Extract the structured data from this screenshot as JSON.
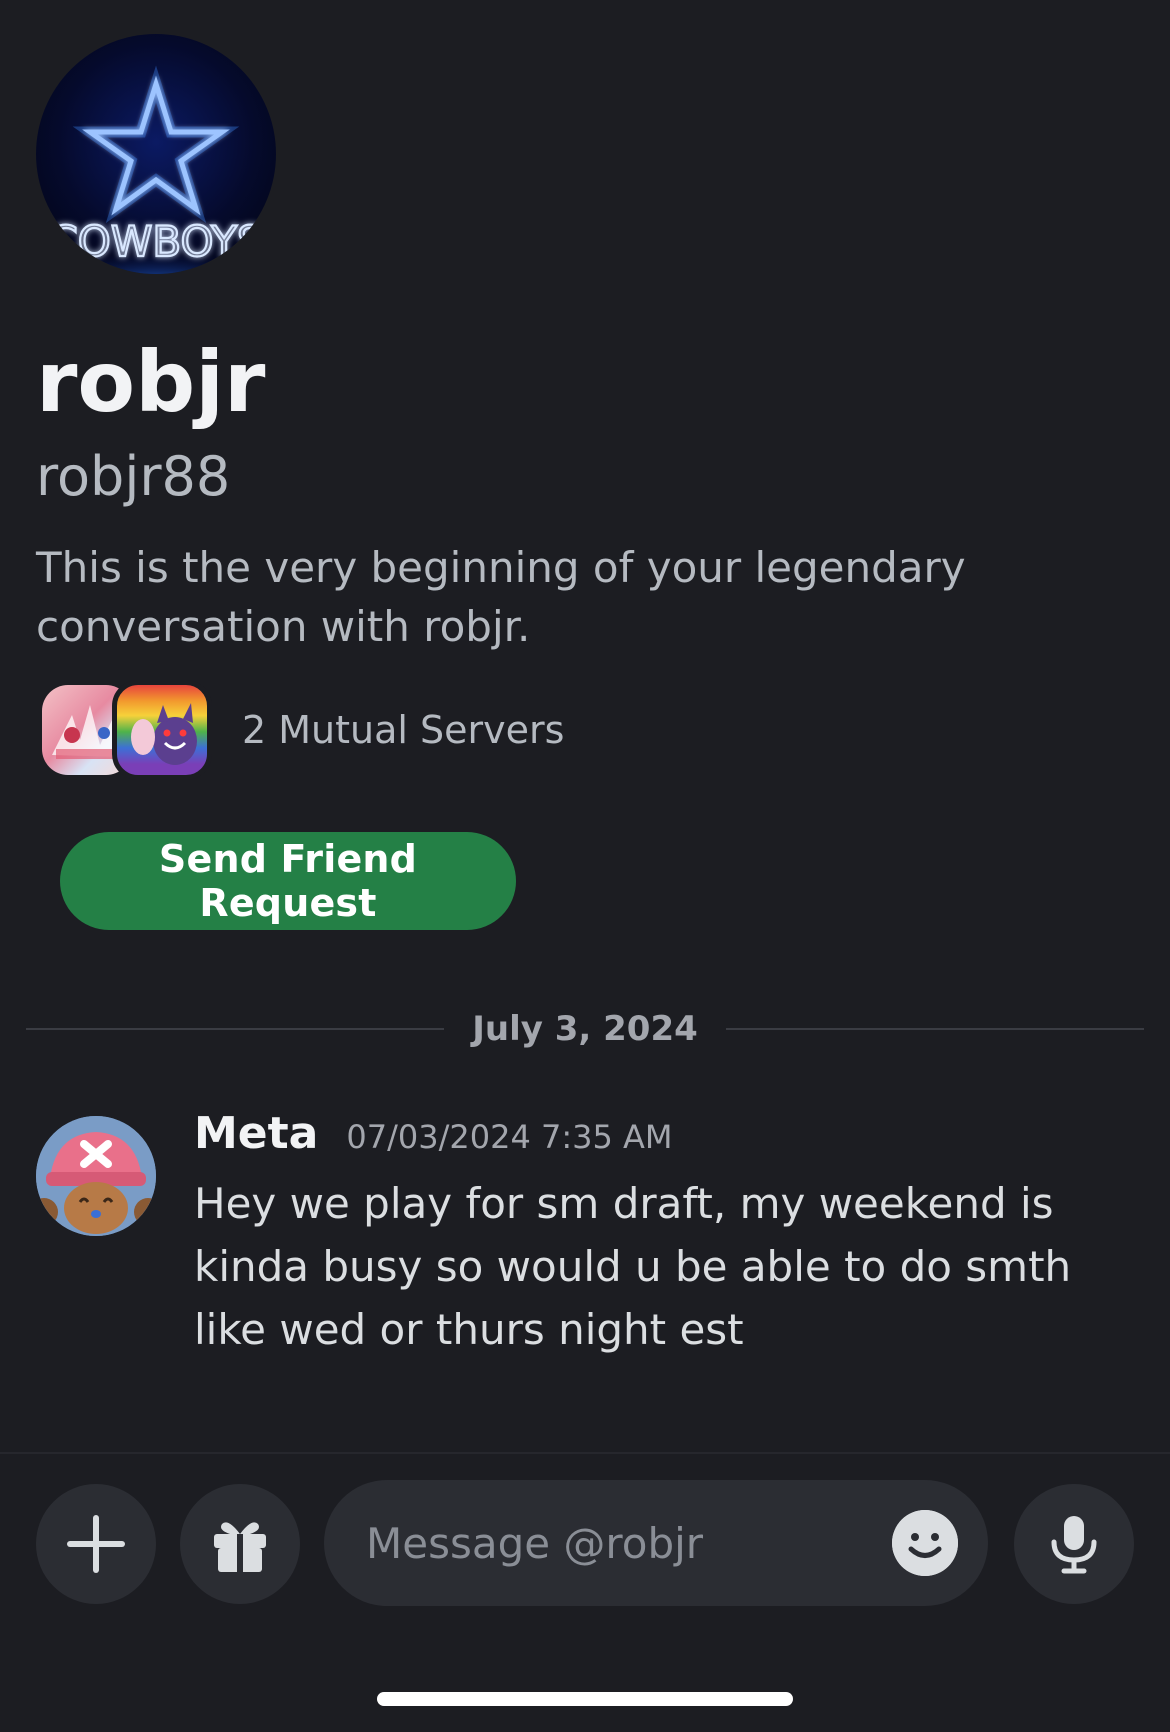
{
  "profile": {
    "avatar_icon": "cowboys-neon-star-logo",
    "avatar_text": "COWBOYS",
    "display_name": "robjr",
    "username": "robjr88",
    "intro": "This is the very beginning of your legendary conversation with robjr."
  },
  "mutual_servers": {
    "label": "2 Mutual Servers",
    "icons": [
      "server-icon-pink-art",
      "server-icon-rainbow-gengar"
    ]
  },
  "actions": {
    "friend_request_label": "Send Friend Request",
    "friend_request_color": "#248046"
  },
  "chat": {
    "date_divider": "July 3, 2024",
    "messages": [
      {
        "author": "Meta",
        "timestamp": "07/03/2024 7:35 AM",
        "text": "Hey we play for sm draft, my weekend is kinda busy so would u be able to do smth like wed or thurs night est",
        "avatar_icon": "chopper-avatar"
      }
    ]
  },
  "composer": {
    "placeholder": "Message @robjr",
    "buttons": [
      "plus-icon",
      "gift-icon",
      "emoji-icon",
      "microphone-icon"
    ]
  },
  "colors": {
    "background": "#1c1d22",
    "secondary_text": "#b5bac1",
    "input_background": "#2b2d33"
  }
}
